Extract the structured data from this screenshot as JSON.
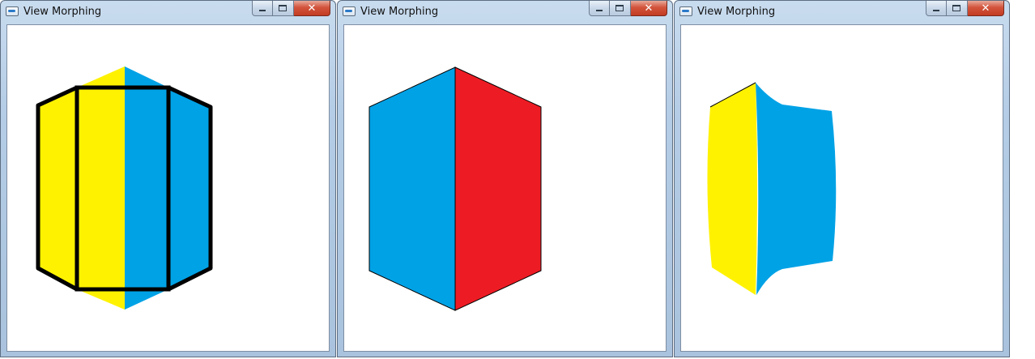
{
  "windows": [
    {
      "title": "View Morphing",
      "controls": {
        "minimize_icon": "minimize-icon",
        "maximize_icon": "maximize-icon",
        "close_label": "✕"
      }
    },
    {
      "title": "View Morphing",
      "controls": {
        "minimize_icon": "minimize-icon",
        "maximize_icon": "maximize-icon",
        "close_label": "✕"
      }
    },
    {
      "title": "View Morphing",
      "controls": {
        "minimize_icon": "minimize-icon",
        "maximize_icon": "maximize-icon",
        "close_label": "✕"
      }
    }
  ],
  "colors": {
    "yellow": "#fff200",
    "blue": "#00a2e6",
    "red": "#ed1c24",
    "outline": "#000000"
  }
}
